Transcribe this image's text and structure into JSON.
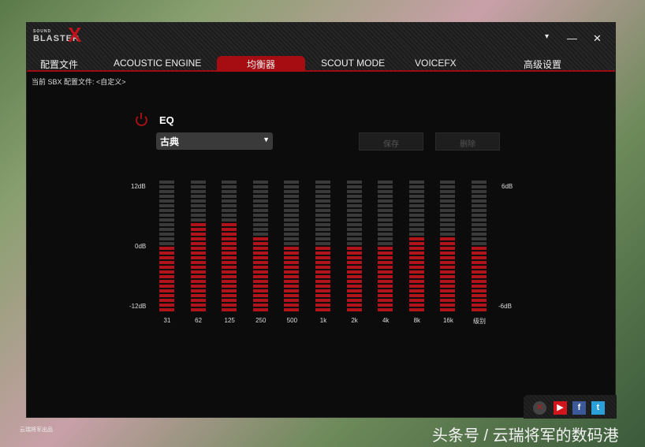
{
  "app": {
    "logo_small": "SOUND",
    "logo": "BLASTER",
    "logo_x": "X"
  },
  "window_controls": {
    "menu": "▾",
    "minimize": "—",
    "close": "✕"
  },
  "tabs": [
    {
      "label": "配置文件"
    },
    {
      "label": "ACOUSTIC ENGINE"
    },
    {
      "label": "均衡器"
    },
    {
      "label": "SCOUT MODE"
    },
    {
      "label": "VOICEFX"
    },
    {
      "label": "高级设置"
    }
  ],
  "active_tab": "均衡器",
  "breadcrumb": "当前 SBX 配置文件: <自定义>",
  "eq": {
    "title": "EQ",
    "preset": "古典",
    "save": "保存",
    "delete": "删除",
    "left_scale": [
      "12dB",
      "0dB",
      "-12dB"
    ],
    "right_scale": [
      "6dB",
      "-6dB"
    ],
    "bands": [
      {
        "label": "31",
        "db": 0
      },
      {
        "label": "62",
        "db": 4
      },
      {
        "label": "125",
        "db": 4
      },
      {
        "label": "250",
        "db": 2
      },
      {
        "label": "500",
        "db": 0
      },
      {
        "label": "1k",
        "db": 0
      },
      {
        "label": "2k",
        "db": 0
      },
      {
        "label": "4k",
        "db": 0
      },
      {
        "label": "8k",
        "db": 2
      },
      {
        "label": "16k",
        "db": 2
      },
      {
        "label": "级别",
        "db": 0,
        "range": 6
      }
    ]
  },
  "accent": "#a50d12",
  "footer": "云瑞将军出品",
  "watermark": "头条号 / 云瑞将军的数码港"
}
